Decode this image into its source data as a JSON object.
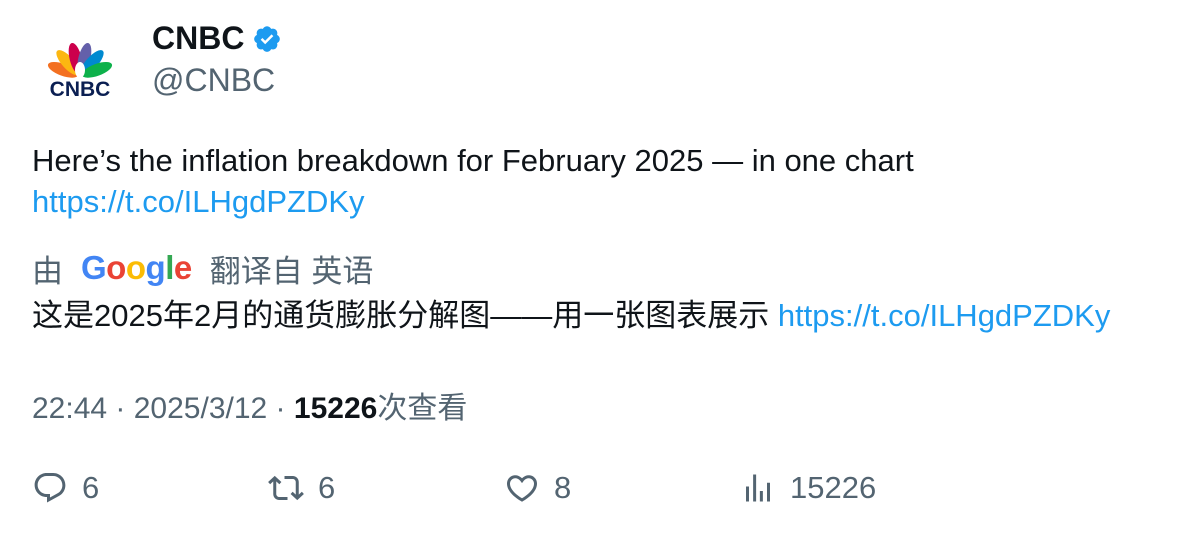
{
  "account": {
    "display_name": "CNBC",
    "handle": "@CNBC",
    "logo_text": "CNBC",
    "verified": true
  },
  "tweet": {
    "text": "Here’s the inflation breakdown for February 2025 — in one chart",
    "link": "https://t.co/ILHgdPZDKy"
  },
  "translation": {
    "prefix": "由",
    "provider": "Google",
    "suffix": "翻译自 英语",
    "text": "这是2025年2月的通货膨胀分解图——用一张图表展示",
    "link": "https://t.co/ILHgdPZDKy"
  },
  "meta": {
    "time": "22:44",
    "separator": " · ",
    "date": "2025/3/12",
    "views_count": "15226",
    "views_label": "次查看"
  },
  "actions": {
    "replies": "6",
    "reposts": "6",
    "likes": "8",
    "views": "15226"
  },
  "colors": {
    "link": "#1d9bf0",
    "secondary_text": "#536471",
    "primary_text": "#0f1419",
    "verified_badge": "#1d9bf0"
  },
  "icons": [
    "cnbc-peacock-logo",
    "verified-badge-icon",
    "google-logo",
    "reply-icon",
    "repost-icon",
    "like-icon",
    "views-icon"
  ]
}
